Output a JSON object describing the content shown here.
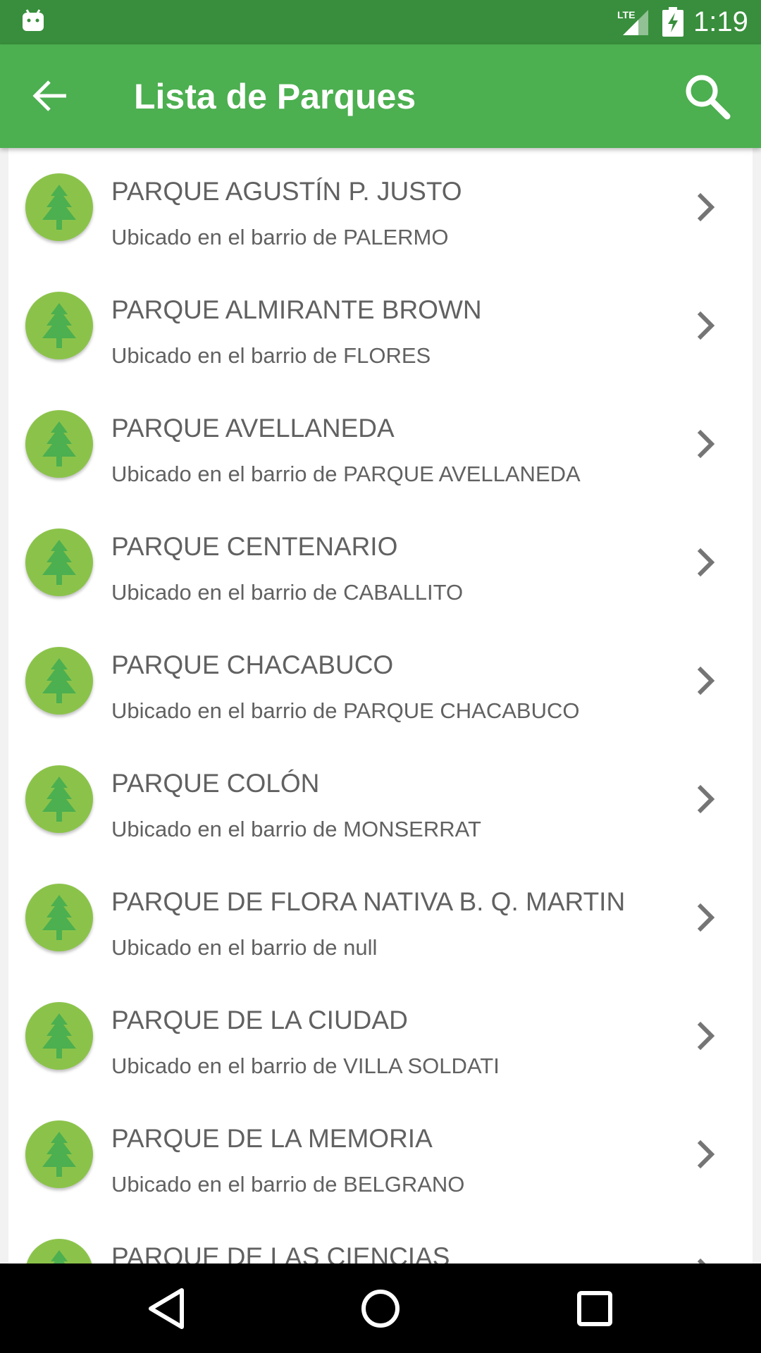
{
  "status_bar": {
    "network": "LTE",
    "time": "1:19",
    "icons": [
      "android-icon",
      "lte-signal-icon",
      "battery-charging-icon"
    ]
  },
  "toolbar": {
    "title": "Lista de Parques",
    "back_icon": "arrow-back-icon",
    "search_icon": "search-icon",
    "color": "#4caf50"
  },
  "parks": [
    {
      "name": "PARQUE AGUSTÍN P. JUSTO",
      "location": "Ubicado en el barrio de PALERMO"
    },
    {
      "name": "PARQUE ALMIRANTE BROWN",
      "location": "Ubicado en el barrio de FLORES"
    },
    {
      "name": "PARQUE AVELLANEDA",
      "location": "Ubicado en el barrio de PARQUE AVELLANEDA"
    },
    {
      "name": "PARQUE CENTENARIO",
      "location": "Ubicado en el barrio de CABALLITO"
    },
    {
      "name": "PARQUE CHACABUCO",
      "location": "Ubicado en el barrio de PARQUE CHACABUCO"
    },
    {
      "name": "PARQUE COLÓN",
      "location": "Ubicado en el barrio de MONSERRAT"
    },
    {
      "name": "PARQUE DE FLORA NATIVA B. Q. MARTIN",
      "location": "Ubicado en el barrio de null"
    },
    {
      "name": "PARQUE DE LA CIUDAD",
      "location": "Ubicado en el barrio de VILLA SOLDATI"
    },
    {
      "name": "PARQUE DE LA MEMORIA",
      "location": "Ubicado en el barrio de BELGRANO"
    },
    {
      "name": "PARQUE DE LAS CIENCIAS",
      "location": ""
    }
  ],
  "list_item_icons": {
    "avatar": "tree-icon",
    "chevron": "chevron-right-icon"
  },
  "colors": {
    "status_bar": "#388e3c",
    "avatar": "#8bc34a",
    "tree": "#4caf50",
    "text": "#616161"
  },
  "nav_bar": {
    "icons": [
      "back-triangle-icon",
      "home-circle-icon",
      "recents-square-icon"
    ]
  }
}
